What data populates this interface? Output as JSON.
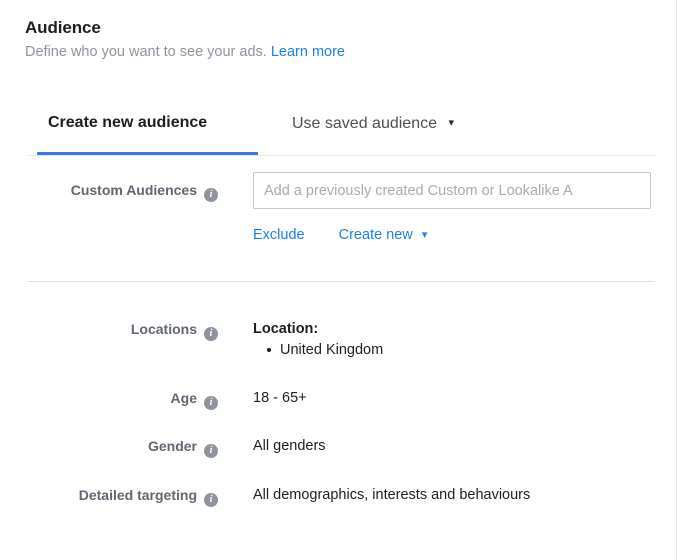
{
  "header": {
    "title": "Audience",
    "subtitle": "Define who you want to see your ads.",
    "learn_more": "Learn more"
  },
  "tabs": [
    {
      "label": "Create new audience",
      "active": true
    },
    {
      "label": "Use saved audience",
      "active": false,
      "caret": "▾"
    }
  ],
  "custom_audiences": {
    "label": "Custom Audiences",
    "info": "i",
    "placeholder": "Add a previously created Custom or Lookalike A",
    "value": "",
    "exclude_label": "Exclude",
    "create_new_label": "Create new",
    "create_new_caret": "▾"
  },
  "summary": {
    "locations": {
      "label": "Locations",
      "info": "i",
      "value_title": "Location:",
      "items": [
        "United Kingdom"
      ]
    },
    "age": {
      "label": "Age",
      "info": "i",
      "value": "18 - 65+"
    },
    "gender": {
      "label": "Gender",
      "info": "i",
      "value": "All genders"
    },
    "detailed_targeting": {
      "label": "Detailed targeting",
      "info": "i",
      "value": "All demographics, interests and behaviours"
    }
  },
  "colors": {
    "accent_blue": "#3578e5",
    "link_blue": "#1d7fe8",
    "label_grey": "#606770",
    "text_dark": "#1c1e21",
    "muted_grey": "#8d949e",
    "border": "#e0e2e6",
    "input_border": "#bec7d8"
  }
}
